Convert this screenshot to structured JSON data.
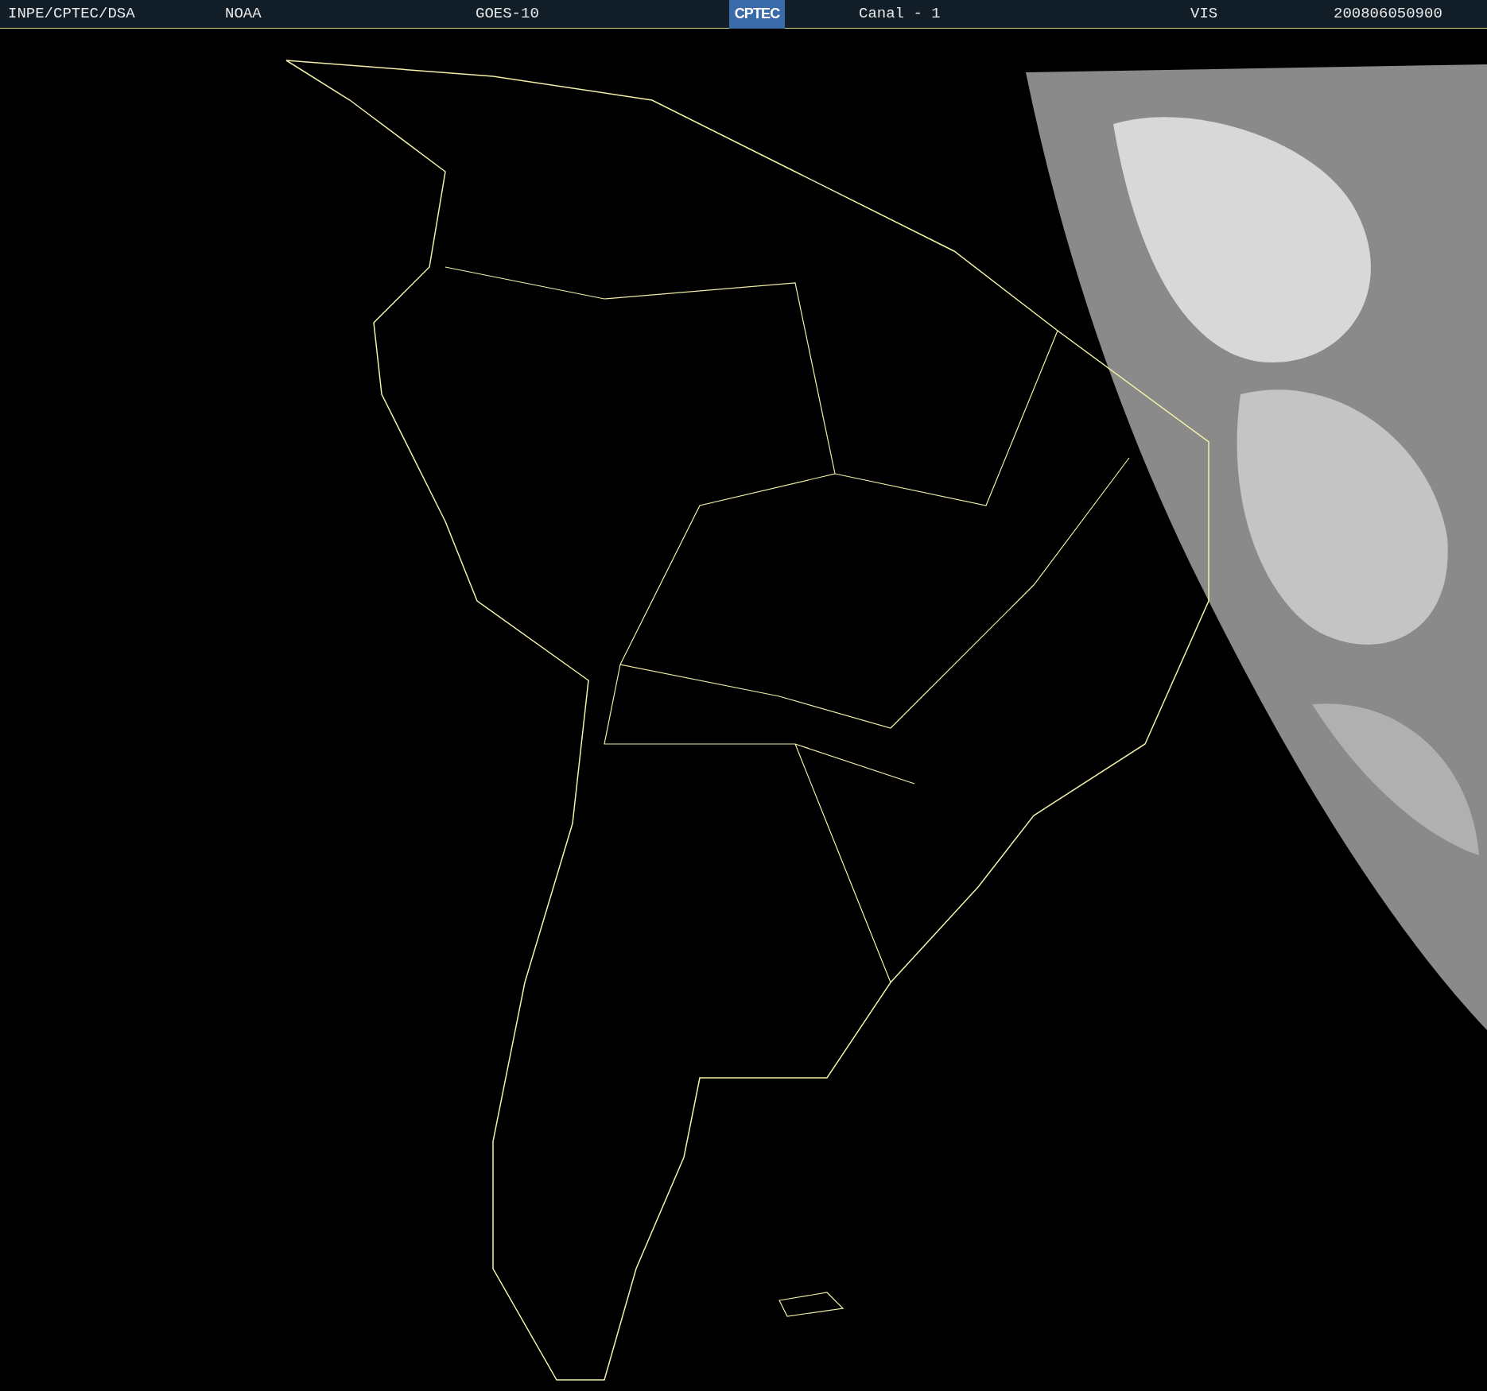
{
  "header": {
    "agency": "INPE/CPTEC/DSA",
    "source": "NOAA",
    "satellite": "GOES-10",
    "logo": "CPTEC",
    "channel": "Canal - 1",
    "band": "VIS",
    "timestamp": "200806050900"
  }
}
